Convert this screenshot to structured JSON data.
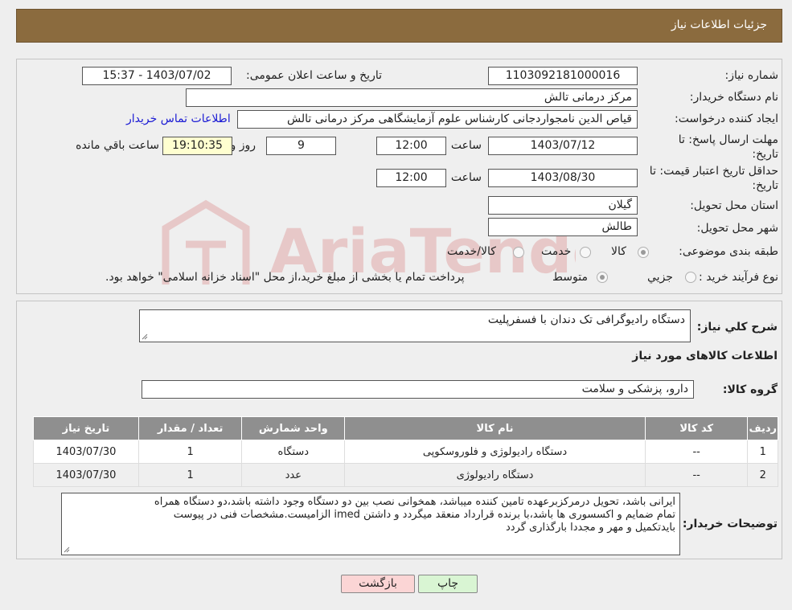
{
  "header": {
    "title": "جزئیات اطلاعات نیاز"
  },
  "fields": {
    "need_number_label": "شماره نیاز:",
    "need_number": "1103092181000016",
    "announce_label": "تاریخ و ساعت اعلان عمومی:",
    "announce_value": "1403/07/02 - 15:37",
    "buyer_org_label": "نام دستگاه خریدار:",
    "buyer_org": "مرکز درمانی تالش",
    "creator_label": "ایجاد کننده درخواست:",
    "creator": "قیاص الدین نامجواردجانی کارشناس علوم آزمایشگاهی مرکز درمانی تالش",
    "contact_link": "اطلاعات تماس خریدار",
    "deadline_label_1": "مهلت ارسال پاسخ: تا",
    "deadline_label_2": "تاریخ:",
    "deadline_date": "1403/07/12",
    "time_word": "ساعت",
    "deadline_time": "12:00",
    "days_value": "9",
    "days_word": "روز و",
    "remaining_time": "19:10:35",
    "remaining_label": "ساعت باقي مانده",
    "validity_label_1": "حداقل تاریخ اعتبار قیمت: تا",
    "validity_label_2": "تاریخ:",
    "validity_date": "1403/08/30",
    "validity_time": "12:00",
    "province_label": "استان محل تحویل:",
    "province": "گیلان",
    "city_label": "شهر محل تحویل:",
    "city": "طالش",
    "category_label": "طبقه بندی موضوعی:",
    "category_options": [
      "کالا",
      "خدمت",
      "کالا/خدمت"
    ],
    "process_label": "نوع فرآیند خرید :",
    "process_options": [
      "جزیي",
      "متوسط"
    ],
    "process_note": "پرداخت تمام یا بخشی از مبلغ خرید،از محل \"اسناد خزانه اسلامی\" خواهد بود."
  },
  "summary": {
    "label": "شرح کلي نیاز:",
    "value": "دستگاه رادیوگرافی تک دندان با فسفرپلیت"
  },
  "goods": {
    "section_title": "اطلاعات کالاهای مورد نیاز",
    "group_label": "گروه کالا:",
    "group_value": "دارو، پزشکی و سلامت",
    "columns": [
      "ردیف",
      "کد کالا",
      "نام کالا",
      "واحد شمارش",
      "تعداد / مقدار",
      "تاریخ نیاز"
    ],
    "rows": [
      [
        "1",
        "--",
        "دستگاه رادیولوژی و فلوروسکوپی",
        "دستگاه",
        "1",
        "1403/07/30"
      ],
      [
        "2",
        "--",
        "دستگاه رادیولوژی",
        "عدد",
        "1",
        "1403/07/30"
      ]
    ]
  },
  "buyer_notes": {
    "label": "توضیحات خریدار:",
    "lines": [
      "ایرانی باشد، تحویل درمرکزبرعهده تامین کننده میباشد، همخوانی نصب  بین دو دستگاه وجود داشته باشد،دو دستگاه همراه",
      "تمام ضمایم و اکسسوری ها باشد،با برنده قرارداد منعقد میگردد و داشتن imed الزامیست.مشخصات فنی در پیوست",
      "بایدتکمیل و مهر و مجددا بارگذاری گردد"
    ]
  },
  "buttons": {
    "print": "چاپ",
    "back": "بازگشت"
  },
  "colors": {
    "header_bg": "#8b6b3e",
    "time_box_bg": "#ffffd0",
    "link": "#1a1ad4"
  }
}
